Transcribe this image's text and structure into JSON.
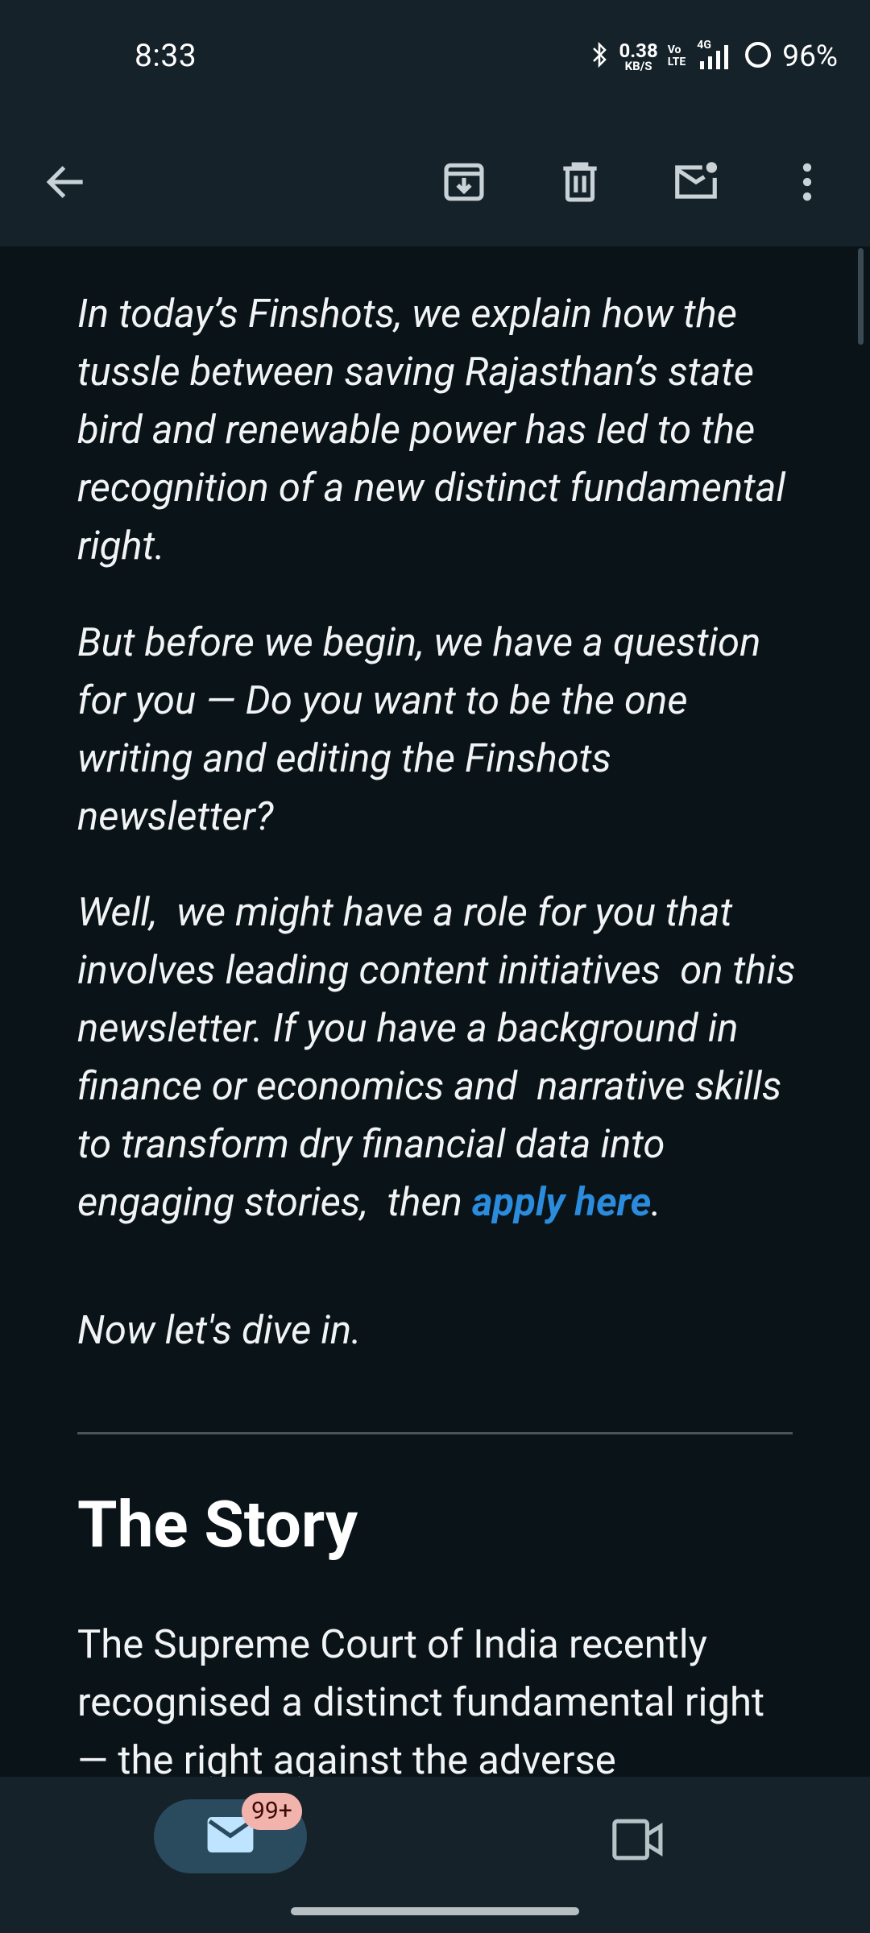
{
  "status_bar": {
    "time": "8:33",
    "net_speed_value": "0.38",
    "net_speed_unit": "KB/S",
    "volte_top": "Vo",
    "volte_bottom": "LTE",
    "network": "4G",
    "battery": "96%"
  },
  "toolbar": {
    "icons": [
      "back-arrow-icon",
      "archive-icon",
      "delete-icon",
      "mark-unread-icon",
      "more-vert-icon"
    ]
  },
  "email": {
    "intro_paragraph": "In today’s Finshots, we explain how the tussle between saving Rajasthan’s state bird and renewable power has led to the recognition of a new distinct fundamental right.",
    "question_paragraph": "But before we begin, we have a question for you — Do you want to be the one writing and editing the Finshots newsletter?",
    "role_paragraph_prefix": "Well,  we might have a role for you that involves leading content initiatives  on this newsletter. If you have a background in finance or economics and  narrative skills to transform dry financial data into engaging stories,  then ",
    "role_link": "apply here",
    "role_paragraph_suffix": ".",
    "dive_in": "Now let's dive in.",
    "section_title": "The Story",
    "story_paragraph": "The Supreme Court of India recently recognised a distinct fundamental right — the right against the adverse"
  },
  "bottom_nav": {
    "mail_badge": "99+",
    "icons": [
      "mail-icon",
      "video-icon"
    ]
  },
  "colors": {
    "background": "#0a1418",
    "bars": "#15222a",
    "link": "#2b8cde",
    "badge": "#f3b3ad",
    "active_pill": "#2a4a5e"
  }
}
